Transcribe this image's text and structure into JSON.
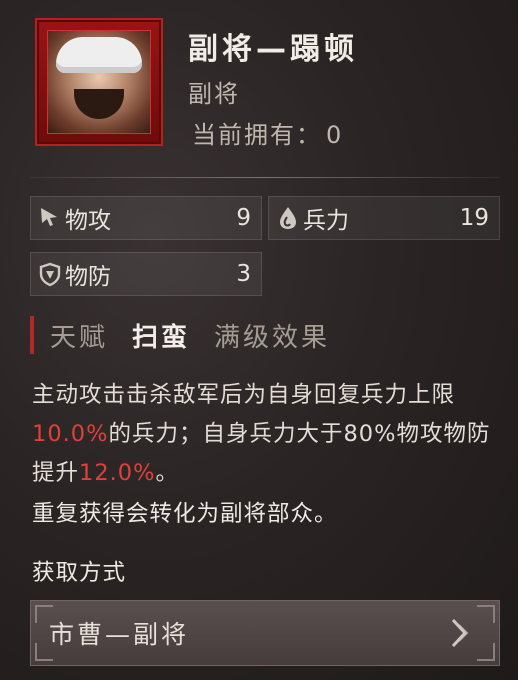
{
  "header": {
    "title": "副将—蹋顿",
    "type": "副将",
    "owned_label": "当前拥有：",
    "owned_value": "0"
  },
  "stats": {
    "attack": {
      "label": "物攻",
      "value": "9",
      "icon": "sword-cursor-icon"
    },
    "troops": {
      "label": "兵力",
      "value": "19",
      "icon": "flame-drop-icon"
    },
    "defense": {
      "label": "物防",
      "value": "3",
      "icon": "shield-icon"
    }
  },
  "talent": {
    "label": "天赋",
    "name": "扫蛮",
    "suffix": "满级效果"
  },
  "description": {
    "part1": "主动攻击击杀敌军后为自身回复兵力上限",
    "val1": "10.0%",
    "part2": "的兵力；自身兵力大于80%物攻物防提升",
    "val2": "12.0%",
    "part3": "。"
  },
  "note": "重复获得会转化为副将部众。",
  "acquire": {
    "heading": "获取方式",
    "source_label": "市曹—副将"
  },
  "colors": {
    "highlight": "#e0403a",
    "card_red": "#9a1414",
    "talent_bar": "#b12a2a"
  }
}
